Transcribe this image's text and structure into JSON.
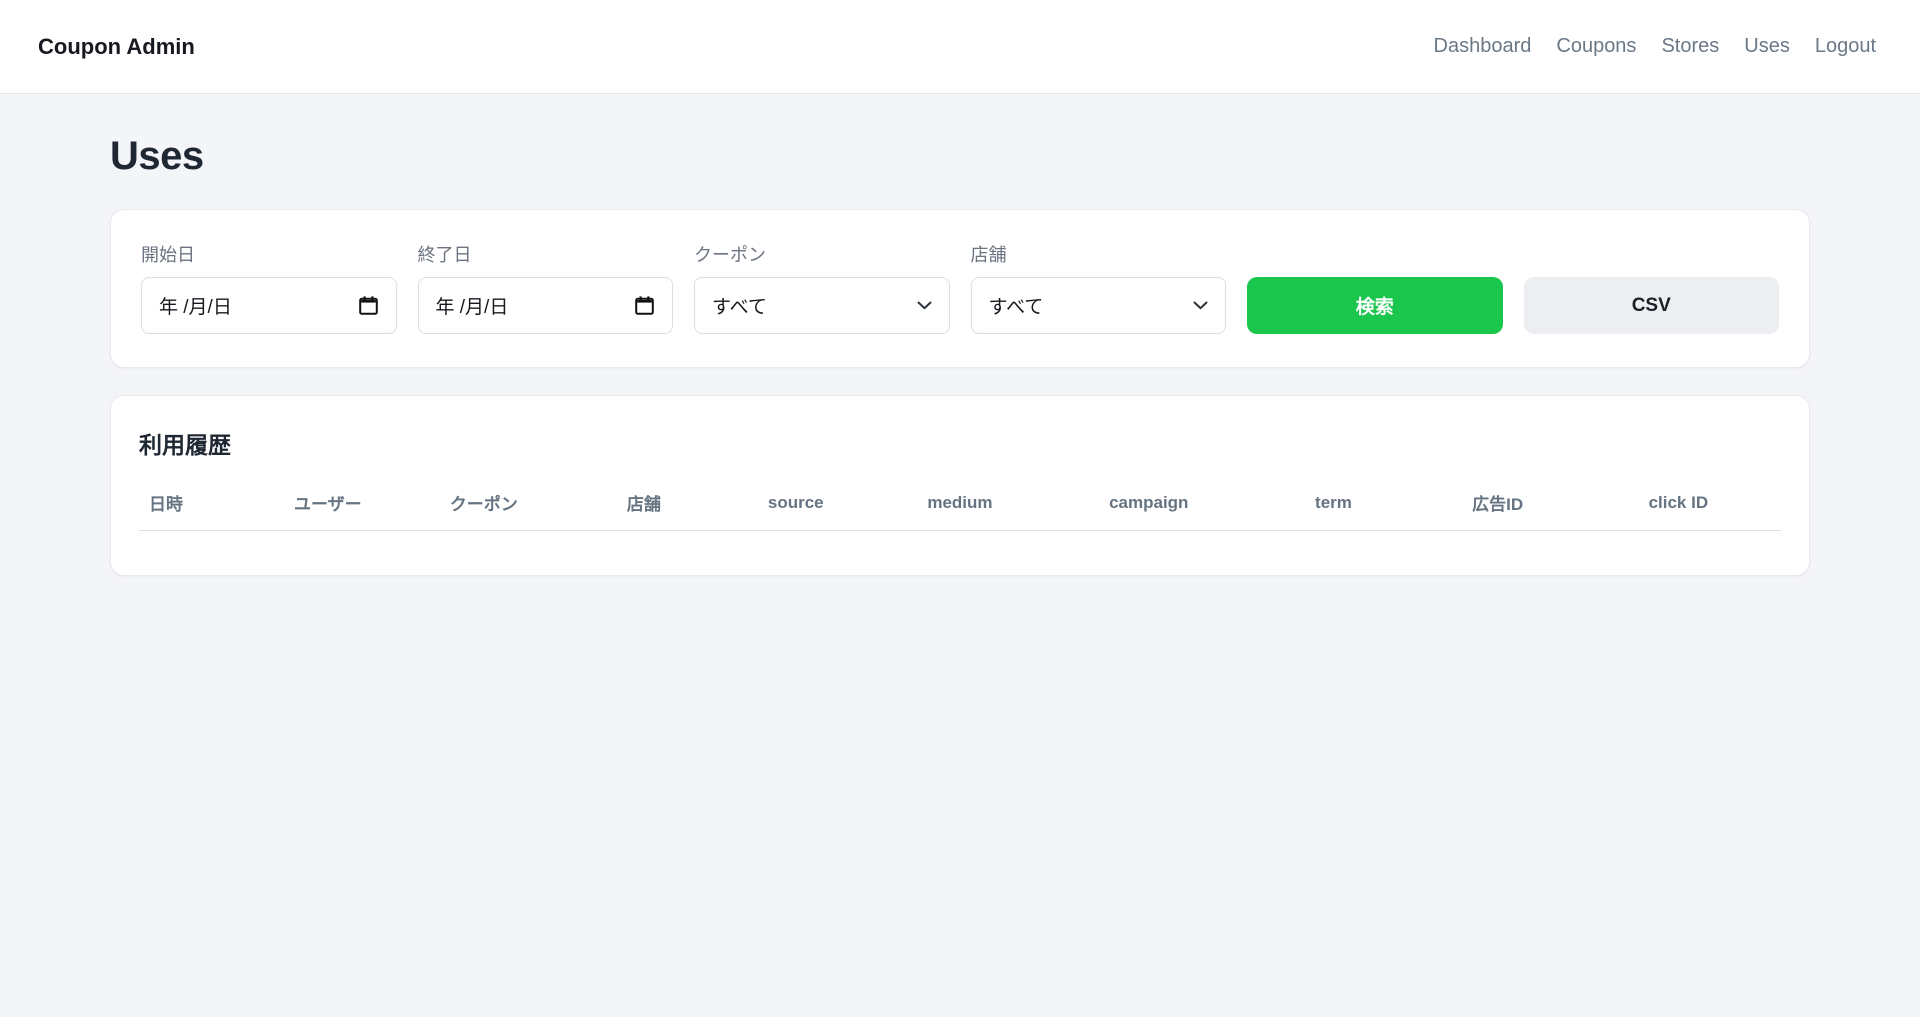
{
  "navbar": {
    "brand": "Coupon Admin",
    "links": [
      {
        "label": "Dashboard"
      },
      {
        "label": "Coupons"
      },
      {
        "label": "Stores"
      },
      {
        "label": "Uses"
      },
      {
        "label": "Logout"
      }
    ]
  },
  "page": {
    "title": "Uses"
  },
  "filters": {
    "start_date": {
      "label": "開始日",
      "placeholder": "年 /月/日"
    },
    "end_date": {
      "label": "終了日",
      "placeholder": "年 /月/日"
    },
    "coupon": {
      "label": "クーポン",
      "value": "すべて"
    },
    "store": {
      "label": "店舗",
      "value": "すべて"
    },
    "search_button": "検索",
    "csv_button": "CSV"
  },
  "history": {
    "title": "利用履歴",
    "columns": [
      "日時",
      "ユーザー",
      "クーポン",
      "店舗",
      "source",
      "medium",
      "campaign",
      "term",
      "広告ID",
      "click ID"
    ],
    "rows": []
  },
  "colors": {
    "accent_green": "#1bc64d",
    "page_background": "#f4f5f8",
    "nav_link": "#6b7886"
  }
}
